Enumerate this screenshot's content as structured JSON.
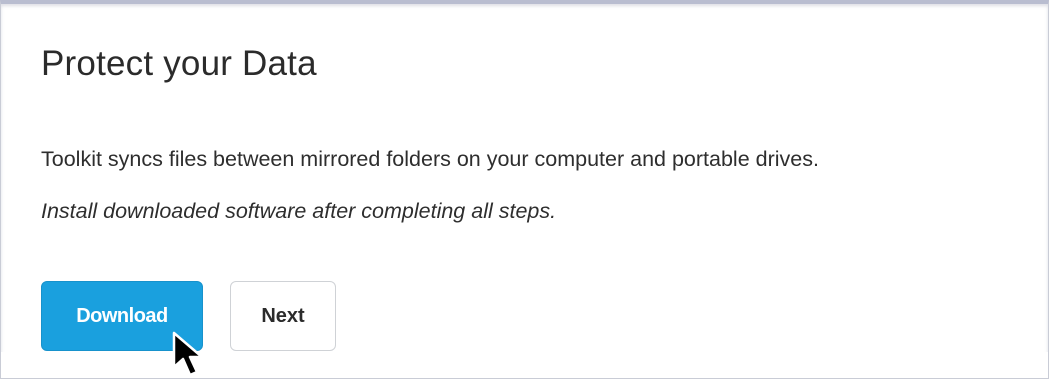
{
  "dialog": {
    "title": "Protect your Data",
    "description": "Toolkit syncs files between mirrored folders on your computer and portable drives.",
    "note": "Install downloaded software after completing all steps."
  },
  "buttons": {
    "download_label": "Download",
    "next_label": "Next"
  },
  "colors": {
    "primary_button": "#1aa0de",
    "secondary_button_border": "#cfd2d6"
  },
  "pointer": {
    "icon": "arrow-pointer-icon"
  }
}
